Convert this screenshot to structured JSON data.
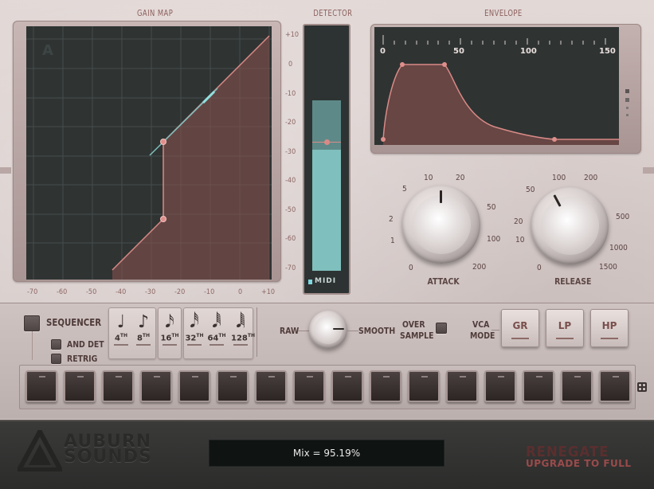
{
  "panels": {
    "gain_map": "GAIN MAP",
    "detector": "DETECTOR",
    "envelope": "ENVELOPE"
  },
  "gain_map": {
    "x_ticks": [
      "-70",
      "-60",
      "-50",
      "-40",
      "-30",
      "-20",
      "-10",
      "0",
      "+10"
    ],
    "y_ticks": [
      "+10",
      "0",
      "-10",
      "-20",
      "-30",
      "-40",
      "-50",
      "-60",
      "-70"
    ],
    "corner_glyph": "A"
  },
  "detector": {
    "midi_label": "MIDI"
  },
  "envelope": {
    "ticks": [
      "0",
      "50",
      "100",
      "150"
    ]
  },
  "attack": {
    "label": "ATTACK",
    "scale": [
      "0",
      "1",
      "2",
      "5",
      "10",
      "20",
      "50",
      "100",
      "200"
    ]
  },
  "release": {
    "label": "RELEASE",
    "scale": [
      "0",
      "10",
      "20",
      "50",
      "100",
      "200",
      "500",
      "1000",
      "1500"
    ]
  },
  "sequencer": {
    "label": "SEQUENCER",
    "and_det": "AND DET",
    "retrig": "RETRIG",
    "notes": [
      {
        "num": "4",
        "sup": "TH",
        "glyph": "♩"
      },
      {
        "num": "8",
        "sup": "TH",
        "glyph": "♪"
      },
      {
        "num": "16",
        "sup": "TH",
        "glyph": "𝅘𝅥𝅯"
      },
      {
        "num": "32",
        "sup": "TH",
        "glyph": "𝅘𝅥𝅰"
      },
      {
        "num": "64",
        "sup": "TH",
        "glyph": "𝅘𝅥𝅱"
      },
      {
        "num": "128",
        "sup": "TH",
        "glyph": "𝅘𝅥𝅲"
      }
    ],
    "step_count": 16
  },
  "detector_mode": {
    "raw": "RAW",
    "smooth": "SMOOTH",
    "over_sample_1": "OVER",
    "over_sample_2": "SAMPLE",
    "vca_mode_1": "VCA",
    "vca_mode_2": "MODE",
    "buttons": [
      "GR",
      "LP",
      "HP"
    ]
  },
  "footer": {
    "brand_line1": "AUBURN",
    "brand_line2": "SOUNDS",
    "status": "Mix = 95.19%",
    "product": "RENEGATE",
    "upgrade": "UPGRADE TO FULL"
  },
  "colors": {
    "accent": "#d98a86",
    "meter": "#7fbfbd",
    "screen": "#2f3433"
  }
}
